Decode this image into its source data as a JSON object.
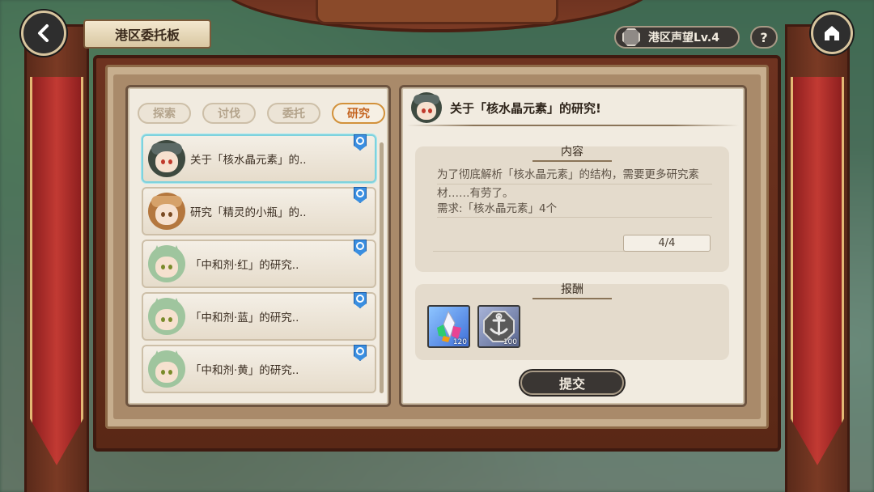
{
  "header": {
    "title": "港区委托板",
    "reputation_label": "港区声望Lv.4",
    "help_label": "?"
  },
  "tabs": [
    {
      "label": "探索",
      "active": false
    },
    {
      "label": "讨伐",
      "active": false
    },
    {
      "label": "委托",
      "active": false
    },
    {
      "label": "研究",
      "active": true
    }
  ],
  "requests": [
    {
      "label": "关于「核水晶元素」的..",
      "avatar": "dark-hair-goggles",
      "selected": true
    },
    {
      "label": "研究「精灵的小瓶」的..",
      "avatar": "brown-hair-goggles",
      "selected": false
    },
    {
      "label": "「中和剂·红」的研究..",
      "avatar": "green-hair-catgirl",
      "selected": false
    },
    {
      "label": "「中和剂·蓝」的研究..",
      "avatar": "green-hair-catgirl",
      "selected": false
    },
    {
      "label": "「中和剂·黄」的研究..",
      "avatar": "green-hair-catgirl",
      "selected": false
    }
  ],
  "detail": {
    "title": "关于「核水晶元素」的研究!",
    "content_label": "内容",
    "description_line1": "为了彻底解析「核水晶元素」的结构，需要更多研究素",
    "description_line2": "材……有劳了。",
    "requirement": "需求:「核水晶元素」4个",
    "progress": "4/4",
    "reward_label": "报酬",
    "rewards": [
      {
        "icon": "crystal-icon",
        "count": "120"
      },
      {
        "icon": "anchor-medal-icon",
        "count": "100"
      }
    ],
    "submit_label": "提交"
  },
  "colors": {
    "accent_active_tab": "#c4631e",
    "selected_border": "#7fd2dd",
    "badge_blue": "#3a8ee0"
  }
}
